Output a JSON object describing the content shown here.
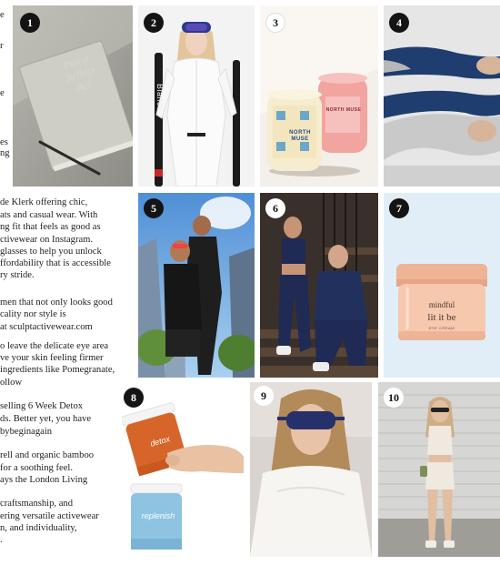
{
  "badges": [
    "1",
    "2",
    "3",
    "4",
    "5",
    "6",
    "7",
    "8",
    "9",
    "10"
  ],
  "article_text": [
    "e",
    "r",
    "e",
    "es",
    "ng",
    "de Klerk offering chic,",
    "ats and casual wear. With",
    "ng fit that feels as good as",
    "ctivewear on Instagram.",
    "glasses to help you unlock",
    "ffordability that is accessible",
    "ry stride.",
    "men that not only looks good",
    "cality nor style is",
    "at sculptactivewear.com",
    "o leave the delicate eye area",
    "ve your skin feeling firmer",
    "ingredients like Pomegranate,",
    "ollow",
    "selling 6 Week Detox",
    "ds. Better yet, you have",
    "bybeginagain",
    "rell and organic bamboo",
    "for a soothing feel.",
    "ays the London Living",
    "craftsmanship, and",
    "ering versatile activewear",
    "n, and individuality,",
    "."
  ],
  "products": {
    "book_lines": [
      "Pause",
      "Reflect",
      "Act"
    ],
    "ski_brand": "Blance",
    "candle_brand_lines": [
      "NORTH",
      "MUSE"
    ],
    "candle2_brand": "NORTH MUSE",
    "jar_brand": "mindful",
    "jar_title": "lit it be",
    "jar_sub": "EYE CREAM",
    "tub1_label": "detox",
    "tub2_label": "replenish"
  },
  "colors": {
    "badge_dark": "#141414",
    "navy": "#1f2a55",
    "peach": "#f3b79a",
    "orange": "#d7652a",
    "sky": "#6fa8e0"
  }
}
